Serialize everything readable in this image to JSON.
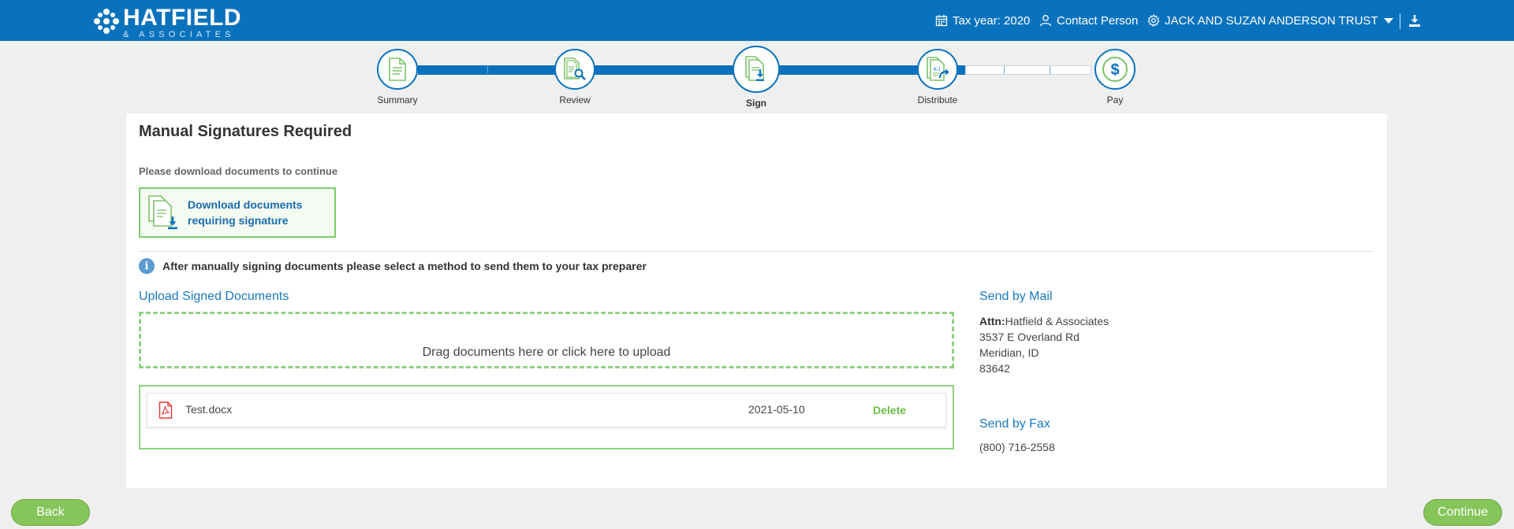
{
  "header": {
    "brand_name": "HATFIELD",
    "brand_sub": "& ASSOCIATES",
    "tax_year": "Tax year: 2020",
    "contact": "Contact Person",
    "account": "JACK AND SUZAN ANDERSON TRUST",
    "colors": {
      "bar": "#0a72bd"
    }
  },
  "stepper": {
    "steps": [
      {
        "label": "Summary",
        "icon": "document-icon",
        "state": "done"
      },
      {
        "label": "Review",
        "icon": "document-search-icon",
        "state": "done"
      },
      {
        "label": "Sign",
        "icon": "document-download-icon",
        "state": "active"
      },
      {
        "label": "Distribute",
        "icon": "k1-share-icon",
        "state": "done"
      },
      {
        "label": "Pay",
        "icon": "dollar-icon",
        "state": "todo"
      }
    ]
  },
  "main": {
    "title": "Manual Signatures Required",
    "instruction": "Please download documents to continue",
    "download_button": "Download documents requiring signature",
    "info_text": "After manually signing documents please select a method to send them to your tax preparer",
    "upload": {
      "heading": "Upload Signed Documents",
      "dropzone_text": "Drag documents here or click here to upload",
      "files": [
        {
          "name": "Test.docx",
          "date": "2021-05-10",
          "action": "Delete"
        }
      ]
    },
    "mail": {
      "heading": "Send by Mail",
      "attn_label": "Attn:",
      "attn_value": "Hatfield & Associates",
      "street": "3537 E Overland Rd",
      "city": "Meridian, ID",
      "zip": "83642"
    },
    "fax": {
      "heading": "Send by Fax",
      "number": "(800) 716-2558"
    }
  },
  "footer": {
    "back": "Back",
    "continue": "Continue",
    "colors": {
      "button": "#86c55a"
    }
  }
}
